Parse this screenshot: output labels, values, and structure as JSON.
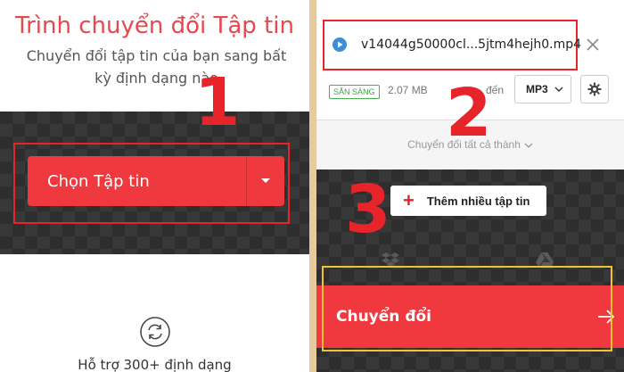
{
  "left": {
    "title": "Trình chuyển đổi Tập tin",
    "subtitle": "Chuyển đổi tập tin của bạn sang bất kỳ định dạng nào",
    "step_number": "1",
    "choose_button_label": "Chọn Tập tin",
    "support_text": "Hỗ trợ 300+ định dạng"
  },
  "right": {
    "file_name": "v14044g50000cl...5jtm4hejh0.mp4",
    "status_badge": "SẴN SÀNG",
    "file_size": "2.07 MB",
    "to_label": "đến",
    "format_value": "MP3",
    "step_number_2": "2",
    "convert_all_text": "Chuyển đổi tất cả thành",
    "step_number_3": "3",
    "add_more_label": "Thêm nhiều tập tin",
    "convert_button_label": "Chuyển đổi"
  },
  "colors": {
    "accent_red": "#f0393e",
    "annotation_red": "#e8242b",
    "annotation_yellow": "#f2c230",
    "ready_green": "#43a047"
  },
  "icons": [
    "chevron-down-icon",
    "sync-icon",
    "play-icon",
    "close-icon",
    "gear-icon",
    "plus-icon",
    "dropbox-icon",
    "google-drive-icon",
    "arrow-right-icon"
  ]
}
